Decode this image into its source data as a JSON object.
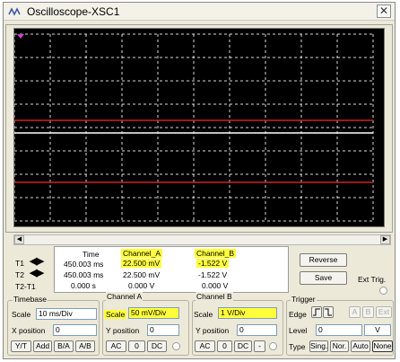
{
  "window": {
    "title": "Oscilloscope-XSC1"
  },
  "readout": {
    "headers": {
      "time": "Time",
      "channel_a": "Channel_A",
      "channel_b": "Channel_B"
    },
    "t1": {
      "label": "T1",
      "time": "450.003 ms",
      "a": "22.500 mV",
      "b": "-1.522 V"
    },
    "t2": {
      "label": "T2",
      "time": "450.003 ms",
      "a": "22.500 mV",
      "b": "-1.522 V"
    },
    "t2t1": {
      "label": "T2-T1",
      "time": "0.000 s",
      "a": "0.000 V",
      "b": "0.000 V"
    }
  },
  "buttons": {
    "reverse": "Reverse",
    "save": "Save",
    "ext_trig": "Ext Trig."
  },
  "timebase": {
    "title": "Timebase",
    "scale_label": "Scale",
    "scale_value": "10 ms/Div",
    "xpos_label": "X position",
    "xpos_value": "0",
    "modes": [
      "Y/T",
      "Add",
      "B/A",
      "A/B"
    ]
  },
  "channel_a": {
    "title": "Channel A",
    "scale_label": "Scale",
    "scale_value": "50 mV/Div",
    "ypos_label": "Y position",
    "ypos_value": "0",
    "coupling": [
      "AC",
      "0",
      "DC"
    ]
  },
  "channel_b": {
    "title": "Channel B",
    "scale_label": "Scale",
    "scale_value": "1  V/Div",
    "ypos_label": "Y position",
    "ypos_value": "0",
    "coupling": [
      "AC",
      "0",
      "DC",
      "-"
    ]
  },
  "trigger": {
    "title": "Trigger",
    "edge_label": "Edge",
    "edge_buttons": [
      "A",
      "B",
      "Ext"
    ],
    "level_label": "Level",
    "level_value": "0",
    "level_unit": "V",
    "type_label": "Type",
    "types": [
      "Sing.",
      "Nor.",
      "Auto",
      "None"
    ]
  },
  "colors": {
    "channel_a_trace": "#ffffff",
    "channel_b_trace": "#cc2222",
    "highlight": "#ffff3a",
    "grid": "#ffffff"
  }
}
